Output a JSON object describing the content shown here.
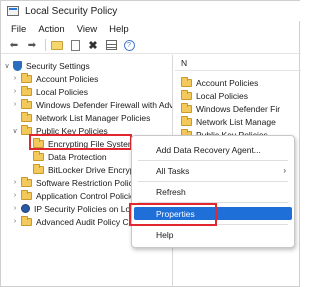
{
  "window": {
    "title": "Local Security Policy"
  },
  "menu": [
    "File",
    "Action",
    "View",
    "Help"
  ],
  "toolbar": [
    "back-icon",
    "forward-icon",
    "folder-icon",
    "document-icon",
    "delete-icon",
    "grid-icon",
    "help-icon"
  ],
  "tree": {
    "root": "Security Settings",
    "items": [
      {
        "label": "Account Policies"
      },
      {
        "label": "Local Policies"
      },
      {
        "label": "Windows Defender Firewall with Adva"
      },
      {
        "label": "Network List Manager Policies"
      },
      {
        "label": "Public Key Policies"
      },
      {
        "label": "Encrypting File System"
      },
      {
        "label": "Data Protection"
      },
      {
        "label": "BitLocker Drive Encrypt"
      },
      {
        "label": "Software Restriction Policie"
      },
      {
        "label": "Application Control Policies"
      },
      {
        "label": "IP Security Policies on Loca"
      },
      {
        "label": "Advanced Audit Policy Cor"
      }
    ]
  },
  "right_pane": {
    "header": "N",
    "items": [
      "Account Policies",
      "Local Policies",
      "Windows Defender Fir",
      "Network List Manage",
      "Public Key Policies"
    ]
  },
  "context_menu": {
    "items": [
      "Add Data Recovery Agent...",
      "All Tasks",
      "Refresh",
      "Properties",
      "Help"
    ],
    "selected": "Properties"
  },
  "colors": {
    "highlight": "#e0262e",
    "selection": "#1f6fd9"
  }
}
